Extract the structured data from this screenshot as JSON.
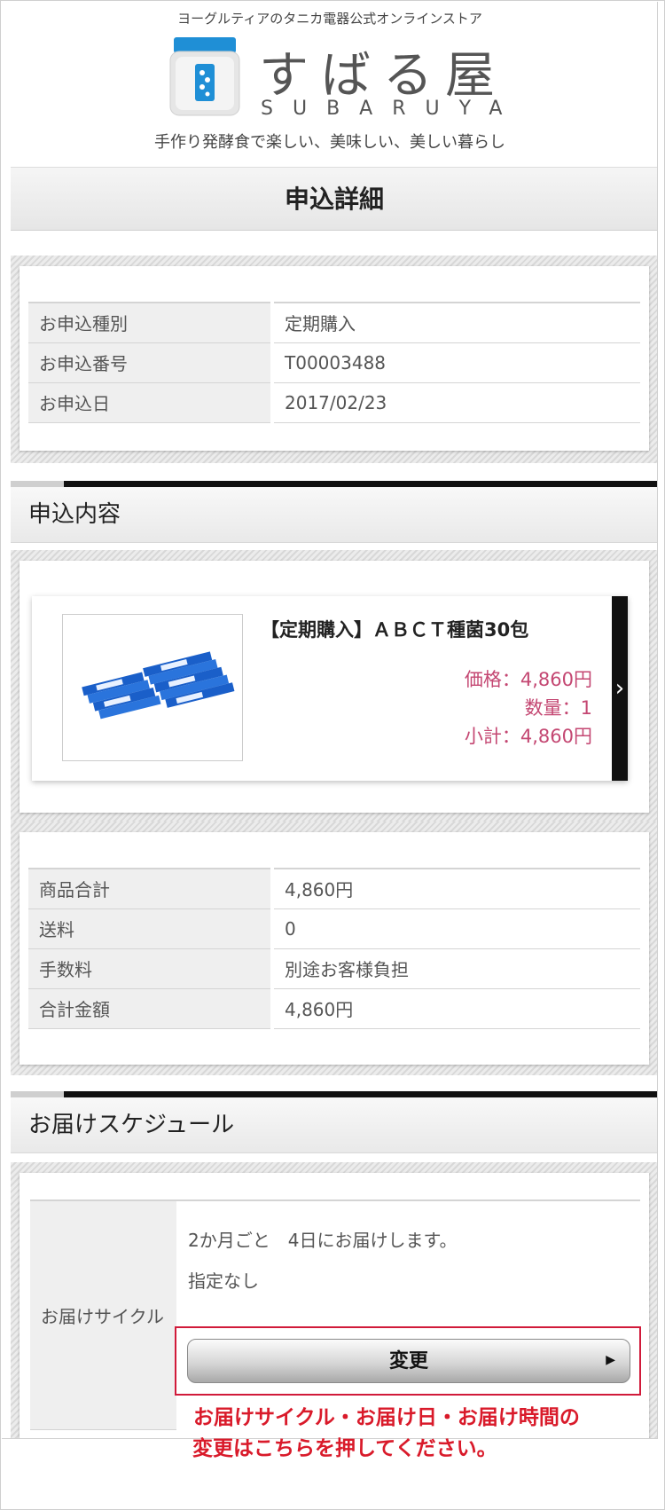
{
  "header": {
    "tagline_top": "ヨーグルティアのタニカ電器公式オンラインストア",
    "brand_name": "すばる屋",
    "brand_roman": "SUBARUYA",
    "tagline_bottom": "手作り発酵食で楽しい、美味しい、美しい暮らし"
  },
  "page_title": "申込詳細",
  "application_info": [
    {
      "label": "お申込種別",
      "value": "定期購入"
    },
    {
      "label": "お申込番号",
      "value": "T00003488"
    },
    {
      "label": "お申込日",
      "value": "2017/02/23"
    }
  ],
  "contents_section": {
    "title": "申込内容",
    "product": {
      "name": "【定期購入】ＡＢＣＴ種菌30包",
      "price": "価格：4,860円",
      "quantity": "数量：1",
      "subtotal": "小計：4,860円",
      "image_icon": "product-sticks-image",
      "arrow": "›"
    },
    "totals": [
      {
        "label": "商品合計",
        "value": "4,860円"
      },
      {
        "label": "送料",
        "value": "0"
      },
      {
        "label": "手数料",
        "value": "別途お客様負担"
      },
      {
        "label": "合計金額",
        "value": "4,860円"
      }
    ]
  },
  "schedule_section": {
    "title": "お届けスケジュール",
    "label": "お届けサイクル",
    "cycle_text": "2か月ごと　4日にお届けします。",
    "time_text": "指定なし",
    "change_button": "変更",
    "note_line1": "お届けサイクル・お届け日・お届け時間の",
    "note_line2": "変更はこちらを押してください。"
  },
  "colors": {
    "price_pink": "#c44772",
    "note_red": "#d91a2a",
    "highlight_border": "#d11a3a",
    "logo_blue": "#1f8fd6"
  }
}
